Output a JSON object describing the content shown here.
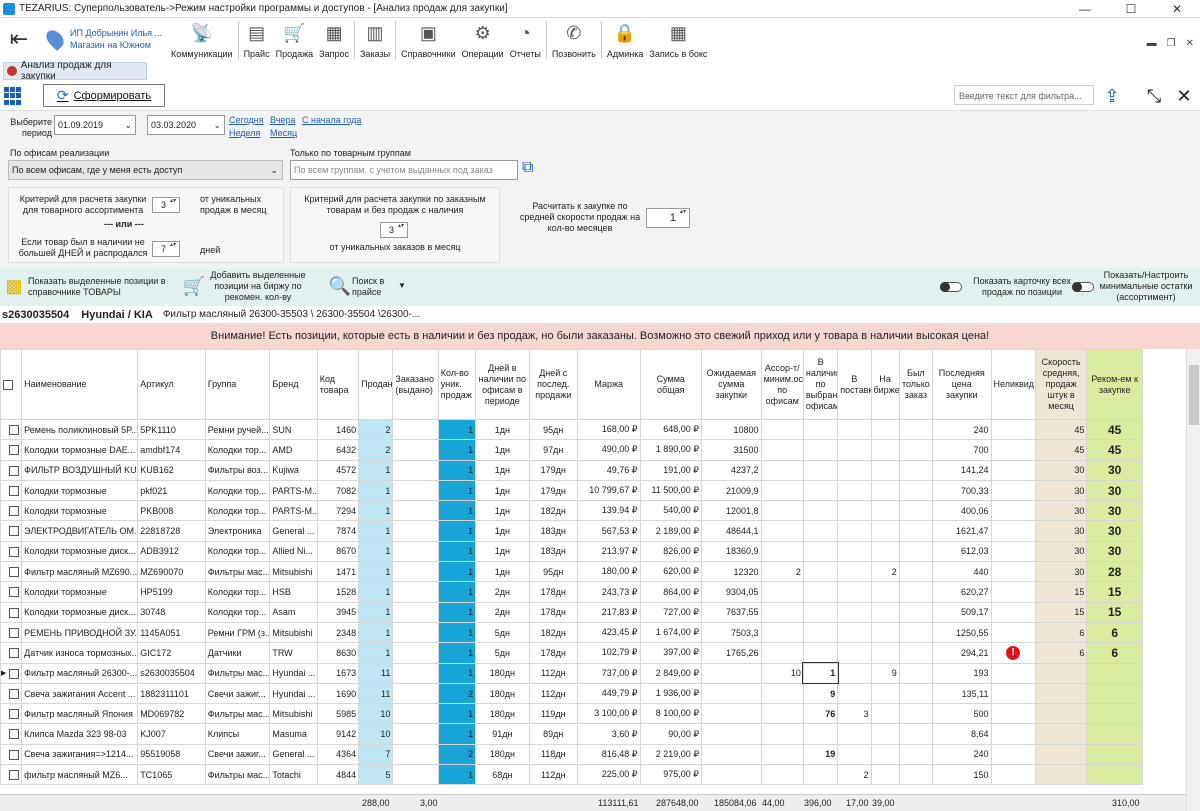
{
  "window": {
    "title": "TEZARIUS: Суперпользователь->Режим настройки программы и доступов - [Анализ продаж для закупки]",
    "controls": [
      "—",
      "☐",
      "✕"
    ]
  },
  "toolbar": {
    "location_line1": "ИП Добрынин Илья ...",
    "location_line2": "Магазин на Южном",
    "items": [
      {
        "label": "Коммуникации",
        "icon": "antenna-icon"
      },
      {
        "label": "Прайс",
        "icon": "price-icon"
      },
      {
        "label": "Продажа",
        "icon": "cart-icon"
      },
      {
        "label": "Запрос",
        "icon": "request-icon"
      },
      {
        "label": "Заказы",
        "icon": "orders-icon"
      },
      {
        "label": "Справочники",
        "icon": "book-icon"
      },
      {
        "label": "Операции",
        "icon": "gears-icon"
      },
      {
        "label": "Отчеты",
        "icon": "pie-icon"
      },
      {
        "label": "Позвонить",
        "icon": "phone-icon"
      },
      {
        "label": "Админка",
        "icon": "admin-icon"
      },
      {
        "label": "Запись в бокс",
        "icon": "calendar-icon"
      }
    ],
    "right_controls": [
      "▬",
      "❐",
      "✕"
    ]
  },
  "tab": {
    "label": "Анализ продаж для закупки"
  },
  "actions": {
    "form_button": "Сформировать",
    "filter_placeholder": "Введите текст для фильтра..."
  },
  "params": {
    "period_label": "Выберите период",
    "date_from": "01.09.2019",
    "date_to": "03.03.2020",
    "links": [
      "Сегодня",
      "Вчера",
      "С начала года",
      "Неделя",
      "Месяц"
    ],
    "offices_label": "По офисам реализации",
    "offices_value": "По всем офисам, где у меня есть доступ",
    "groups_label": "Только по товарным группам",
    "groups_placeholder": "По всем группам, с учетом выданных под заказ",
    "crit1_text": "Критерий для расчета закупки для товарного ассортимента",
    "crit1_value": "3",
    "crit1_suffix": "от уникальных продаж в месяц",
    "or_text": "--- или ---",
    "crit2_text": "Если товар был в наличии не большей ДНЕЙ и распродался",
    "crit2_value": "7",
    "crit2_suffix": "дней",
    "crit3_text": "Критерий для расчета закупки по заказным товарам и без продаж с наличия",
    "crit3_value": "3",
    "crit3_suffix": "от уникальных заказов в месяц",
    "avg_text": "Расчитать к закупке по средней скорости продаж на кол-во месяцев",
    "avg_value": "1"
  },
  "bluebar": {
    "show_selected": "Показать выделенные позиции в справочнике ТОВАРЫ",
    "add_selected": "Добавить выделенные позиции на биржу по рекомен. кол-ву",
    "search_price": "Поиск в прайсе",
    "show_card": "Показать карточку всех продаж по позиции",
    "show_min": "Показать/Настроить минимальные остатки (ассортимент)"
  },
  "info": {
    "code": "s2630035504",
    "brand": "Hyundai / KIA",
    "desc": "Фильтр масляный 26300-35503 \\ 26300-35504 \\26300-..."
  },
  "warning": "Внимание! Есть позиции, которые есть в наличии и без продаж, но были заказаны. Возможно это свежий приход или у товара в наличии высокая цена!",
  "columns": [
    "",
    "Наименование",
    "Артикул",
    "Группа",
    "Бренд",
    "Код товара",
    "Продано",
    "Заказано (выдано)",
    "Кол-во уник. продаж",
    "Дней в наличии по офисам в периоде",
    "Дней с послед. продажи",
    "Маржа",
    "Сумма общая",
    "Ожидаемая сумма закупки",
    "Ассор-т/миним.остатки по офисам",
    "В наличии по выбранным офисам",
    "В поставке",
    "На бирже",
    "Был только заказ",
    "Последняя цена закупки",
    "Неликвид",
    "Скорость средняя, продаж штук в месяц",
    "Реком-ем к закупке"
  ],
  "rows": [
    {
      "name": "Ремень поликлиновый 5P...",
      "art": "5PK1110",
      "group": "Ремни ручей...",
      "brand": "SUN",
      "code": "1460",
      "sold": "2",
      "ordered": "",
      "uniq": "1",
      "days": "1дн",
      "last": "95дн",
      "margin": "168,00 ₽",
      "sum": "648,00 ₽",
      "exp": "10800",
      "assort": "",
      "avail": "",
      "supply": "",
      "exch": "",
      "only": "",
      "price": "240",
      "illiquid": "",
      "speed": "45",
      "rec": "45"
    },
    {
      "name": "Колодки тормозные DAE...",
      "art": "amdbf174",
      "group": "Колодки тор...",
      "brand": "AMD",
      "code": "6432",
      "sold": "2",
      "ordered": "",
      "uniq": "1",
      "days": "1дн",
      "last": "97дн",
      "margin": "490,00 ₽",
      "sum": "1 890,00 ₽",
      "exp": "31500",
      "assort": "",
      "avail": "",
      "supply": "",
      "exch": "",
      "only": "",
      "price": "700",
      "illiquid": "",
      "speed": "45",
      "rec": "45"
    },
    {
      "name": "ФИЛЬТР ВОЗДУШНЫЙ KU...",
      "art": "KUB162",
      "group": "Фильтры воз...",
      "brand": "Kujiwa",
      "code": "4572",
      "sold": "1",
      "ordered": "",
      "uniq": "1",
      "days": "1дн",
      "last": "179дн",
      "margin": "49,76 ₽",
      "sum": "191,00 ₽",
      "exp": "4237,2",
      "assort": "",
      "avail": "",
      "supply": "",
      "exch": "",
      "only": "",
      "price": "141,24",
      "illiquid": "",
      "speed": "30",
      "rec": "30"
    },
    {
      "name": "Колодки тормозные",
      "art": "pkf021",
      "group": "Колодки тор...",
      "brand": "PARTS-M...",
      "code": "7082",
      "sold": "1",
      "ordered": "",
      "uniq": "1",
      "days": "1дн",
      "last": "179дн",
      "margin": "10 799,67 ₽",
      "sum": "11 500,00 ₽",
      "exp": "21009,9",
      "assort": "",
      "avail": "",
      "supply": "",
      "exch": "",
      "only": "",
      "price": "700,33",
      "illiquid": "",
      "speed": "30",
      "rec": "30"
    },
    {
      "name": "Колодки тормозные",
      "art": "PKB008",
      "group": "Колодки тор...",
      "brand": "PARTS-M...",
      "code": "7294",
      "sold": "1",
      "ordered": "",
      "uniq": "1",
      "days": "1дн",
      "last": "182дн",
      "margin": "139,94 ₽",
      "sum": "540,00 ₽",
      "exp": "12001,8",
      "assort": "",
      "avail": "",
      "supply": "",
      "exch": "",
      "only": "",
      "price": "400,06",
      "illiquid": "",
      "speed": "30",
      "rec": "30"
    },
    {
      "name": "ЭЛЕКТРОДВИГАТЕЛЬ ОМ...",
      "art": "22818728",
      "group": "Электроника",
      "brand": "General ...",
      "code": "7874",
      "sold": "1",
      "ordered": "",
      "uniq": "1",
      "days": "1дн",
      "last": "183дн",
      "margin": "567,53 ₽",
      "sum": "2 189,00 ₽",
      "exp": "48644,1",
      "assort": "",
      "avail": "",
      "supply": "",
      "exch": "",
      "only": "",
      "price": "1621,47",
      "illiquid": "",
      "speed": "30",
      "rec": "30"
    },
    {
      "name": "Колодки тормозные диск...",
      "art": "ADB3912",
      "group": "Колодки тор...",
      "brand": "Allied Ni...",
      "code": "8670",
      "sold": "1",
      "ordered": "",
      "uniq": "1",
      "days": "1дн",
      "last": "183дн",
      "margin": "213,97 ₽",
      "sum": "826,00 ₽",
      "exp": "18360,9",
      "assort": "",
      "avail": "",
      "supply": "",
      "exch": "",
      "only": "",
      "price": "612,03",
      "illiquid": "",
      "speed": "30",
      "rec": "30"
    },
    {
      "name": "Фильтр масляный MZ690...",
      "art": "MZ690070",
      "group": "Фильтры мас...",
      "brand": "Mitsubishi",
      "code": "1471",
      "sold": "1",
      "ordered": "",
      "uniq": "1",
      "days": "1дн",
      "last": "95дн",
      "margin": "180,00 ₽",
      "sum": "620,00 ₽",
      "exp": "12320",
      "assort": "2",
      "avail": "",
      "supply": "",
      "exch": "2",
      "only": "",
      "price": "440",
      "illiquid": "",
      "speed": "30",
      "rec": "28"
    },
    {
      "name": "Колодки тормозные",
      "art": "HP5199",
      "group": "Колодки тор...",
      "brand": "HSB",
      "code": "1528",
      "sold": "1",
      "ordered": "",
      "uniq": "1",
      "days": "2дн",
      "last": "178дн",
      "margin": "243,73 ₽",
      "sum": "864,00 ₽",
      "exp": "9304,05",
      "assort": "",
      "avail": "",
      "supply": "",
      "exch": "",
      "only": "",
      "price": "620,27",
      "illiquid": "",
      "speed": "15",
      "rec": "15"
    },
    {
      "name": "Колодки тормозные диск...",
      "art": "30748",
      "group": "Колодки тор...",
      "brand": "Asam",
      "code": "3945",
      "sold": "1",
      "ordered": "",
      "uniq": "1",
      "days": "2дн",
      "last": "178дн",
      "margin": "217,83 ₽",
      "sum": "727,00 ₽",
      "exp": "7637,55",
      "assort": "",
      "avail": "",
      "supply": "",
      "exch": "",
      "only": "",
      "price": "509,17",
      "illiquid": "",
      "speed": "15",
      "rec": "15"
    },
    {
      "name": "РЕМЕНЬ ПРИВОДНОЙ ЗУ...",
      "art": "1145A051",
      "group": "Ремни ГРМ (з...",
      "brand": "Mitsubishi",
      "code": "2348",
      "sold": "1",
      "ordered": "",
      "uniq": "1",
      "days": "5дн",
      "last": "182дн",
      "margin": "423,45 ₽",
      "sum": "1 674,00 ₽",
      "exp": "7503,3",
      "assort": "",
      "avail": "",
      "supply": "",
      "exch": "",
      "only": "",
      "price": "1250,55",
      "illiquid": "",
      "speed": "6",
      "rec": "6"
    },
    {
      "name": "Датчик износа тормозных...",
      "art": "GIC172",
      "group": "Датчики",
      "brand": "TRW",
      "code": "8630",
      "sold": "1",
      "ordered": "",
      "uniq": "1",
      "days": "5дн",
      "last": "178дн",
      "margin": "102,79 ₽",
      "sum": "397,00 ₽",
      "exp": "1765,26",
      "assort": "",
      "avail": "",
      "supply": "",
      "exch": "",
      "only": "",
      "price": "294,21",
      "illiquid": "!",
      "speed": "6",
      "rec": "6"
    },
    {
      "name": "Фильтр масляный 26300-...",
      "art": "s2630035504",
      "group": "Фильтры мас...",
      "brand": "Hyundai ...",
      "code": "1673",
      "sold": "11",
      "ordered": "",
      "uniq": "1",
      "days": "180дн",
      "last": "112дн",
      "margin": "737,00 ₽",
      "sum": "2 849,00 ₽",
      "exp": "",
      "assort": "10",
      "avail": "1",
      "supply": "",
      "exch": "9",
      "only": "",
      "price": "193",
      "illiquid": "",
      "speed": "",
      "rec": ""
    },
    {
      "name": "Свеча зажигания Accent ...",
      "art": "1882311101",
      "group": "Свечи зажиг...",
      "brand": "Hyundai ...",
      "code": "1690",
      "sold": "11",
      "ordered": "",
      "uniq": "2",
      "days": "180дн",
      "last": "112дн",
      "margin": "449,79 ₽",
      "sum": "1 936,00 ₽",
      "exp": "",
      "assort": "",
      "avail": "9",
      "supply": "",
      "exch": "",
      "only": "",
      "price": "135,11",
      "illiquid": "",
      "speed": "",
      "rec": ""
    },
    {
      "name": "Фильтр масляный  Япония",
      "art": "MD069782",
      "group": "Фильтры мас...",
      "brand": "Mitsubishi",
      "code": "5985",
      "sold": "10",
      "ordered": "",
      "uniq": "1",
      "days": "180дн",
      "last": "119дн",
      "margin": "3 100,00 ₽",
      "sum": "8 100,00 ₽",
      "exp": "",
      "assort": "",
      "avail": "76",
      "supply": "3",
      "exch": "",
      "only": "",
      "price": "500",
      "illiquid": "",
      "speed": "",
      "rec": ""
    },
    {
      "name": "Клипса Mazda 323 98-03",
      "art": "KJ007",
      "group": "Клипсы",
      "brand": "Masuma",
      "code": "9142",
      "sold": "10",
      "ordered": "",
      "uniq": "1",
      "days": "91дн",
      "last": "89дн",
      "margin": "3,60 ₽",
      "sum": "90,00 ₽",
      "exp": "",
      "assort": "",
      "avail": "",
      "supply": "",
      "exch": "",
      "only": "",
      "price": "8,64",
      "illiquid": "",
      "speed": "",
      "rec": ""
    },
    {
      "name": "Свеча зажигания=>1214...",
      "art": "95519058",
      "group": "Свечи зажиг...",
      "brand": "General ...",
      "code": "4364",
      "sold": "7",
      "ordered": "",
      "uniq": "2",
      "days": "180дн",
      "last": "118дн",
      "margin": "816,48 ₽",
      "sum": "2 219,00 ₽",
      "exp": "",
      "assort": "",
      "avail": "19",
      "supply": "",
      "exch": "",
      "only": "",
      "price": "240",
      "illiquid": "",
      "speed": "",
      "rec": ""
    },
    {
      "name": "фильтр масляный   MZ6...",
      "art": "TC1065",
      "group": "Фильтры мас...",
      "brand": "Totachi",
      "code": "4844",
      "sold": "5",
      "ordered": "",
      "uniq": "1",
      "days": "68дн",
      "last": "112дн",
      "margin": "225,00 ₽",
      "sum": "975,00 ₽",
      "exp": "",
      "assort": "",
      "avail": "",
      "supply": "2",
      "exch": "",
      "only": "",
      "price": "150",
      "illiquid": "",
      "speed": "",
      "rec": ""
    }
  ],
  "totals": {
    "sold": "288,00",
    "ordered": "3,00",
    "margin": "113111,61",
    "sum": "287648,00",
    "exp": "185084,06",
    "assort": "44,00",
    "avail": "396,00",
    "supply": "17,00",
    "exch": "39,00",
    "rec": "310,00"
  }
}
